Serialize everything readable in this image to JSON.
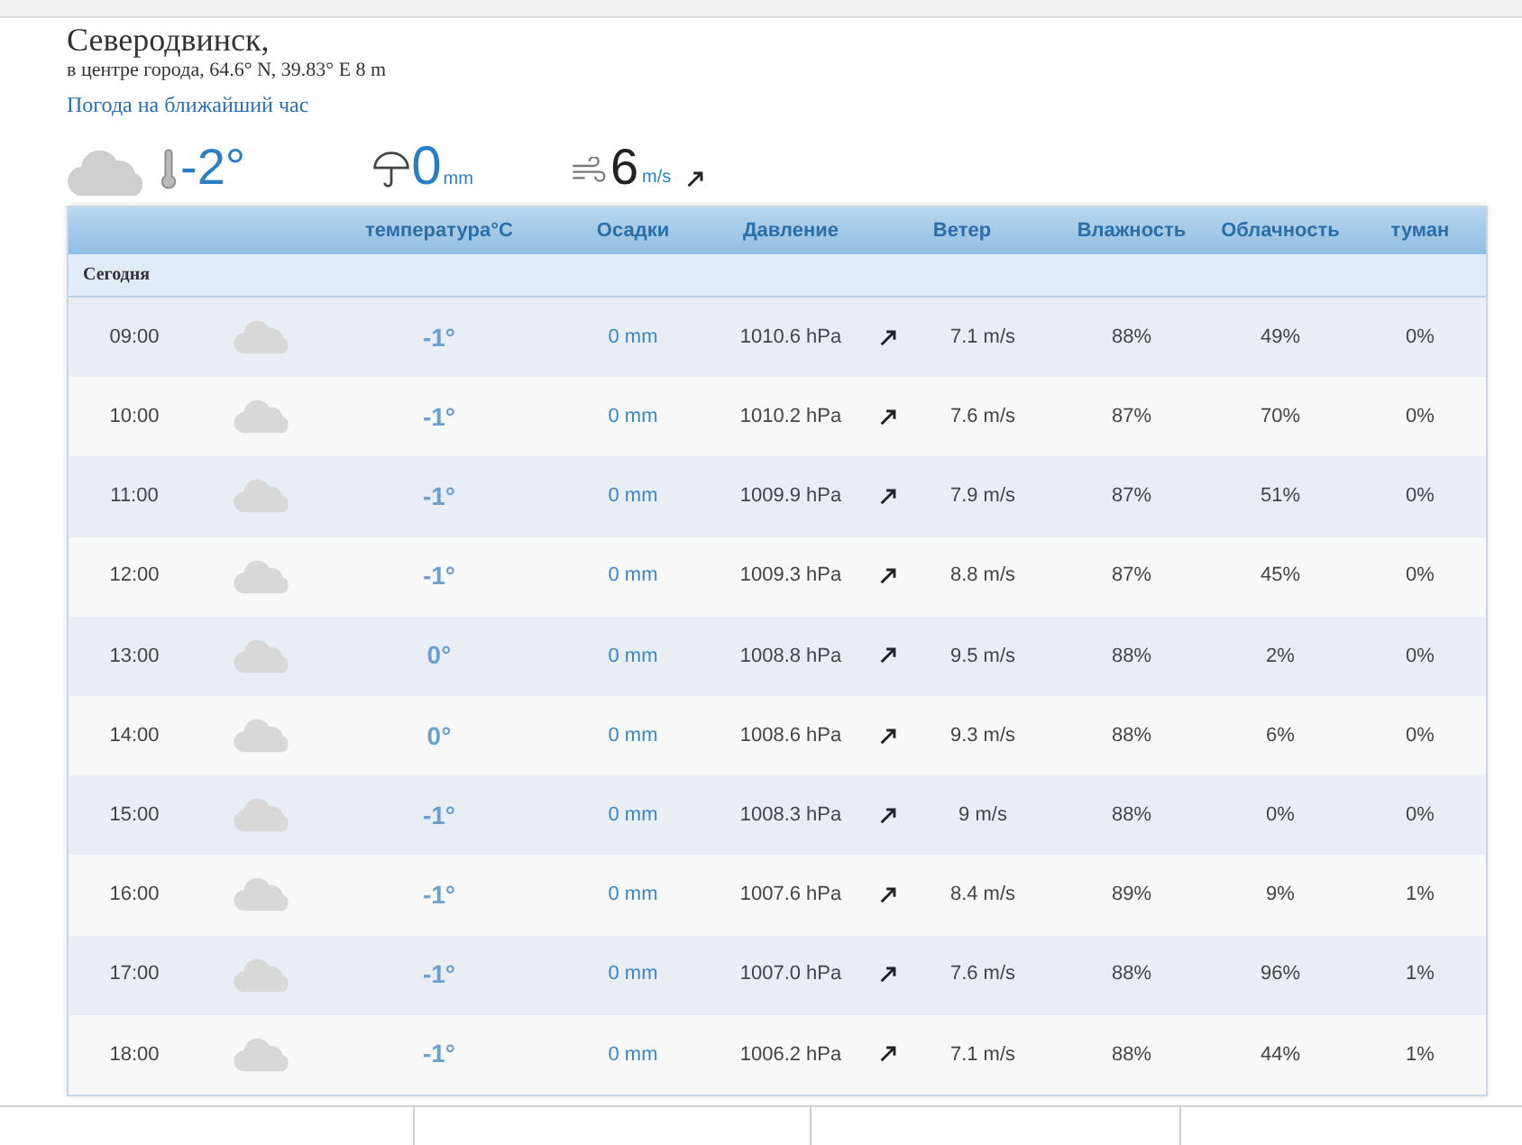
{
  "location": {
    "city": "Северодвинск,",
    "details": "в центре города, 64.6° N, 39.83° E  8 m",
    "link": "Погода на ближайший час"
  },
  "current": {
    "temperature": "-2°",
    "precipitation": "0",
    "precipitation_unit": "mm",
    "wind": "6",
    "wind_unit": "m/s"
  },
  "table": {
    "columns": [
      "",
      "",
      "температура°C",
      "Осадки",
      "Давление",
      "Ветер",
      "Влажность",
      "Облачность",
      "туман"
    ],
    "section": "Сегодня",
    "rows": [
      {
        "time": "09:00",
        "temperature": "-1°",
        "precipitation": "0 mm",
        "pressure": "1010.6 hPa",
        "wind": "7.1 m/s",
        "humidity": "88%",
        "cloudiness": "49%",
        "fog": "0%"
      },
      {
        "time": "10:00",
        "temperature": "-1°",
        "precipitation": "0 mm",
        "pressure": "1010.2 hPa",
        "wind": "7.6 m/s",
        "humidity": "87%",
        "cloudiness": "70%",
        "fog": "0%"
      },
      {
        "time": "11:00",
        "temperature": "-1°",
        "precipitation": "0 mm",
        "pressure": "1009.9 hPa",
        "wind": "7.9 m/s",
        "humidity": "87%",
        "cloudiness": "51%",
        "fog": "0%"
      },
      {
        "time": "12:00",
        "temperature": "-1°",
        "precipitation": "0 mm",
        "pressure": "1009.3 hPa",
        "wind": "8.8 m/s",
        "humidity": "87%",
        "cloudiness": "45%",
        "fog": "0%"
      },
      {
        "time": "13:00",
        "temperature": "0°",
        "precipitation": "0 mm",
        "pressure": "1008.8 hPa",
        "wind": "9.5 m/s",
        "humidity": "88%",
        "cloudiness": "2%",
        "fog": "0%"
      },
      {
        "time": "14:00",
        "temperature": "0°",
        "precipitation": "0 mm",
        "pressure": "1008.6 hPa",
        "wind": "9.3 m/s",
        "humidity": "88%",
        "cloudiness": "6%",
        "fog": "0%"
      },
      {
        "time": "15:00",
        "temperature": "-1°",
        "precipitation": "0 mm",
        "pressure": "1008.3 hPa",
        "wind": "9 m/s",
        "humidity": "88%",
        "cloudiness": "0%",
        "fog": "0%"
      },
      {
        "time": "16:00",
        "temperature": "-1°",
        "precipitation": "0 mm",
        "pressure": "1007.6 hPa",
        "wind": "8.4 m/s",
        "humidity": "89%",
        "cloudiness": "9%",
        "fog": "1%"
      },
      {
        "time": "17:00",
        "temperature": "-1°",
        "precipitation": "0 mm",
        "pressure": "1007.0 hPa",
        "wind": "7.6 m/s",
        "humidity": "88%",
        "cloudiness": "96%",
        "fog": "1%"
      },
      {
        "time": "18:00",
        "temperature": "-1°",
        "precipitation": "0 mm",
        "pressure": "1006.2 hPa",
        "wind": "7.1 m/s",
        "humidity": "88%",
        "cloudiness": "44%",
        "fog": "1%"
      }
    ]
  }
}
